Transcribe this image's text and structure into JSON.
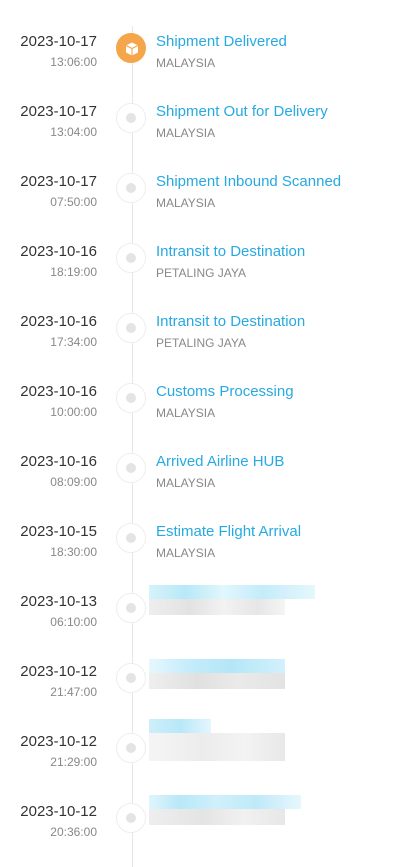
{
  "events": [
    {
      "date": "2023-10-17",
      "time": "13:06:00",
      "status": "Shipment Delivered",
      "location": "MALAYSIA",
      "active": true
    },
    {
      "date": "2023-10-17",
      "time": "13:04:00",
      "status": "Shipment Out for Delivery",
      "location": "MALAYSIA"
    },
    {
      "date": "2023-10-17",
      "time": "07:50:00",
      "status": "Shipment Inbound Scanned",
      "location": "MALAYSIA"
    },
    {
      "date": "2023-10-16",
      "time": "18:19:00",
      "status": "Intransit to Destination",
      "location": "PETALING JAYA"
    },
    {
      "date": "2023-10-16",
      "time": "17:34:00",
      "status": "Intransit to Destination",
      "location": "PETALING JAYA"
    },
    {
      "date": "2023-10-16",
      "time": "10:00:00",
      "status": "Customs Processing",
      "location": "MALAYSIA"
    },
    {
      "date": "2023-10-16",
      "time": "08:09:00",
      "status": "Arrived Airline HUB",
      "location": "MALAYSIA"
    },
    {
      "date": "2023-10-15",
      "time": "18:30:00",
      "status": "Estimate Flight Arrival",
      "location": "MALAYSIA"
    },
    {
      "date": "2023-10-13",
      "time": "06:10:00",
      "redacted": true
    },
    {
      "date": "2023-10-12",
      "time": "21:47:00",
      "redacted": true
    },
    {
      "date": "2023-10-12",
      "time": "21:29:00",
      "redacted": true
    },
    {
      "date": "2023-10-12",
      "time": "20:36:00",
      "redacted": true
    }
  ],
  "colors": {
    "status": "#27a9e1",
    "active_node": "#f5a54a",
    "text": "#333333",
    "muted": "#888888"
  },
  "icons": {
    "active_node": "package-icon"
  }
}
